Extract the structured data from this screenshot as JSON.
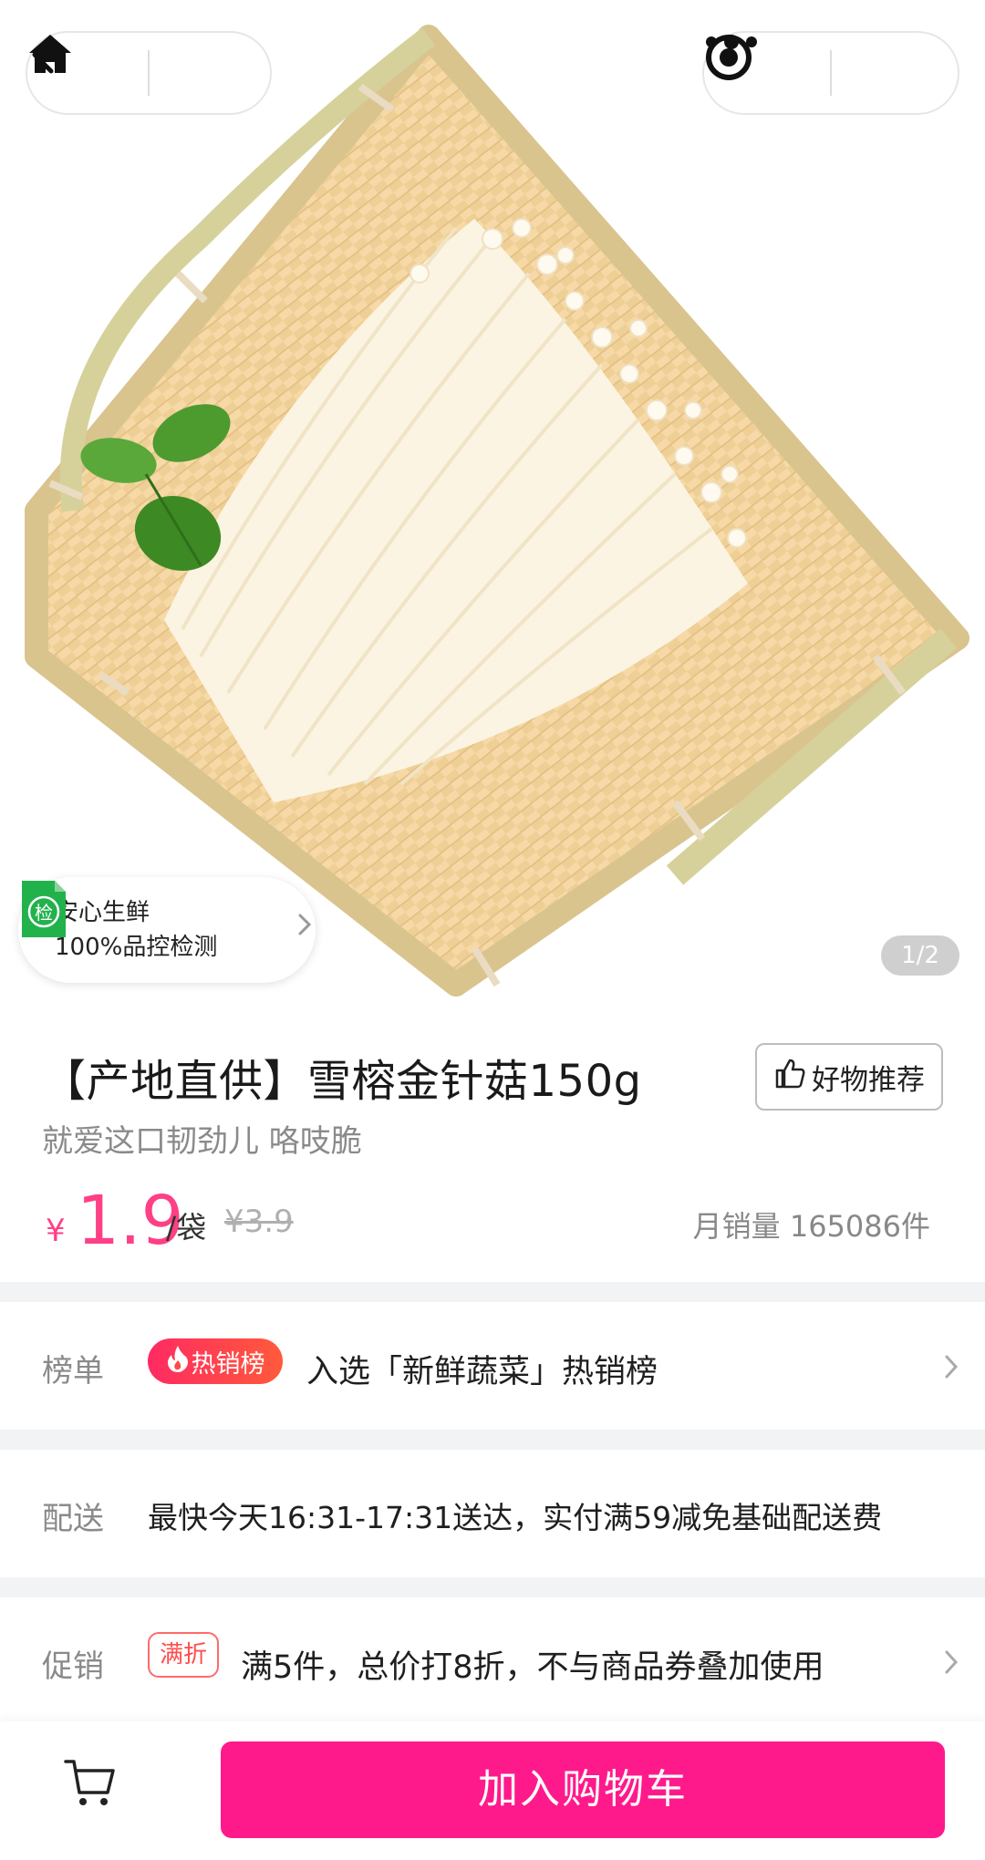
{
  "topbar": {
    "back_icon": "chevron-left-icon",
    "home_icon": "home-icon",
    "more_icon": "more-dots-icon",
    "close_icon": "target-circle-icon"
  },
  "hero": {
    "image_subject": "enoki-mushroom-on-bamboo-tray",
    "quality_badge": {
      "icon_text": "检",
      "line1": "安心生鲜",
      "line2": "100%品控检测"
    },
    "pager": "1/2"
  },
  "product": {
    "title": "【产地直供】雪榕金针菇150g",
    "recommend_label": "好物推荐",
    "subtitle": "就爱这口韧劲儿 咯吱脆",
    "currency": "¥",
    "price": "1.9",
    "unit": "/袋",
    "original_price": "¥3.9",
    "monthly_sales": "月销量 165086件"
  },
  "ranking": {
    "label": "榜单",
    "tag": "热销榜",
    "text": "入选「新鲜蔬菜」热销榜"
  },
  "delivery": {
    "label": "配送",
    "text": "最快今天16:31-17:31送达，实付满59减免基础配送费"
  },
  "promotion": {
    "label": "促销",
    "tag": "满折",
    "text": "满5件，总价打8折，不与商品券叠加使用"
  },
  "bottom_bar": {
    "cart_icon": "shopping-cart-icon",
    "add_to_cart": "加入购物车"
  },
  "colors": {
    "accent": "#ff1a8c",
    "price": "#ff3f86",
    "hot_tag": "#ff2a63",
    "promo_tag": "#ff4d4d",
    "quality_icon": "#22b24c"
  }
}
